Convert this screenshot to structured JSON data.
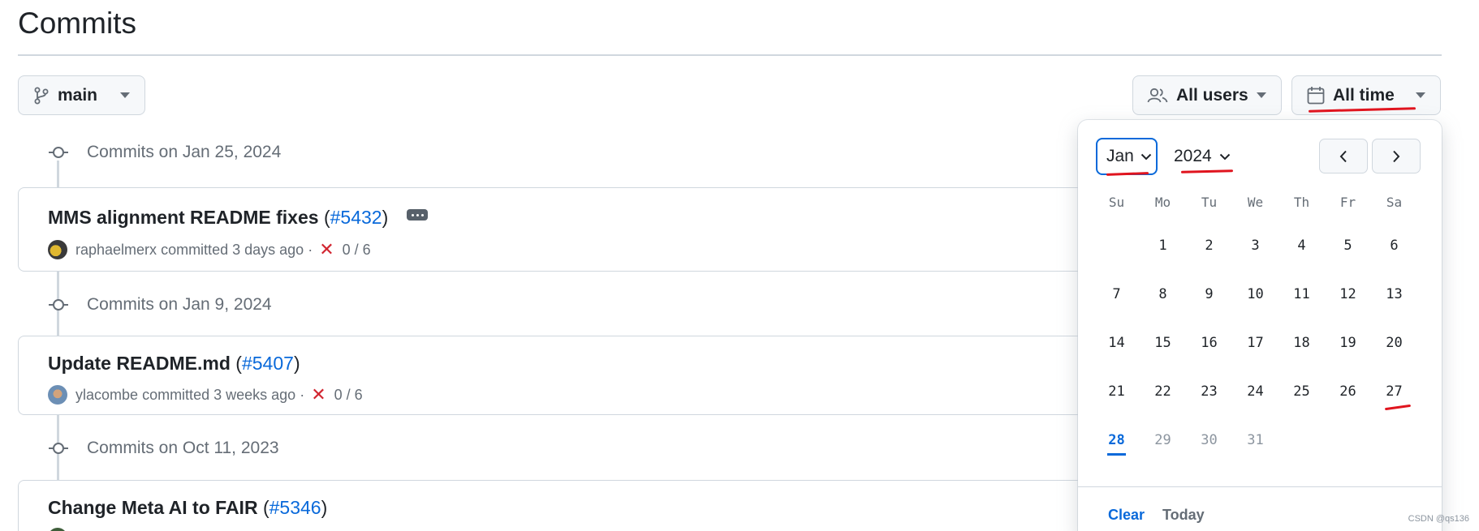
{
  "page": {
    "title": "Commits"
  },
  "toolbar": {
    "branch_label": "main",
    "users_label": "All users",
    "time_label": "All time"
  },
  "groups": [
    {
      "header": "Commits on Jan 25, 2024",
      "commit": {
        "title": "MMS alignment README fixes",
        "pr": "#5432",
        "author": "raphaelmerx",
        "action": "committed",
        "time": "3 days ago",
        "checks": "0 / 6",
        "has_more_button": true
      }
    },
    {
      "header": "Commits on Jan 9, 2024",
      "commit": {
        "title": "Update README.md",
        "pr": "#5407",
        "author": "ylacombe",
        "action": "committed",
        "time": "3 weeks ago",
        "checks": "0 / 6"
      }
    },
    {
      "header": "Commits on Oct 11, 2023",
      "commit": {
        "title": "Change Meta AI to FAIR",
        "pr": "#5346"
      }
    }
  ],
  "date_picker": {
    "month": "Jan",
    "year": "2024",
    "weekdays": [
      "Su",
      "Mo",
      "Tu",
      "We",
      "Th",
      "Fr",
      "Sa"
    ],
    "weeks": [
      [
        "",
        "1",
        "2",
        "3",
        "4",
        "5",
        "6"
      ],
      [
        "7",
        "8",
        "9",
        "10",
        "11",
        "12",
        "13"
      ],
      [
        "14",
        "15",
        "16",
        "17",
        "18",
        "19",
        "20"
      ],
      [
        "21",
        "22",
        "23",
        "24",
        "25",
        "26",
        "27"
      ],
      [
        "28",
        "29",
        "30",
        "31",
        "",
        "",
        ""
      ]
    ],
    "today": "28",
    "disabled_days": [
      "29",
      "30",
      "31"
    ],
    "clear_label": "Clear",
    "today_label": "Today"
  },
  "watermark": "CSDN @qs136",
  "colors": {
    "accent": "#0969da",
    "danger": "#d1242f",
    "annotation": "#e0141e",
    "border": "#d0d7de",
    "muted": "#656d76"
  },
  "icons": {
    "branch": "git-branch-icon",
    "users": "people-icon",
    "time": "calendar-icon",
    "commit": "git-commit-icon",
    "fail": "x-icon"
  }
}
